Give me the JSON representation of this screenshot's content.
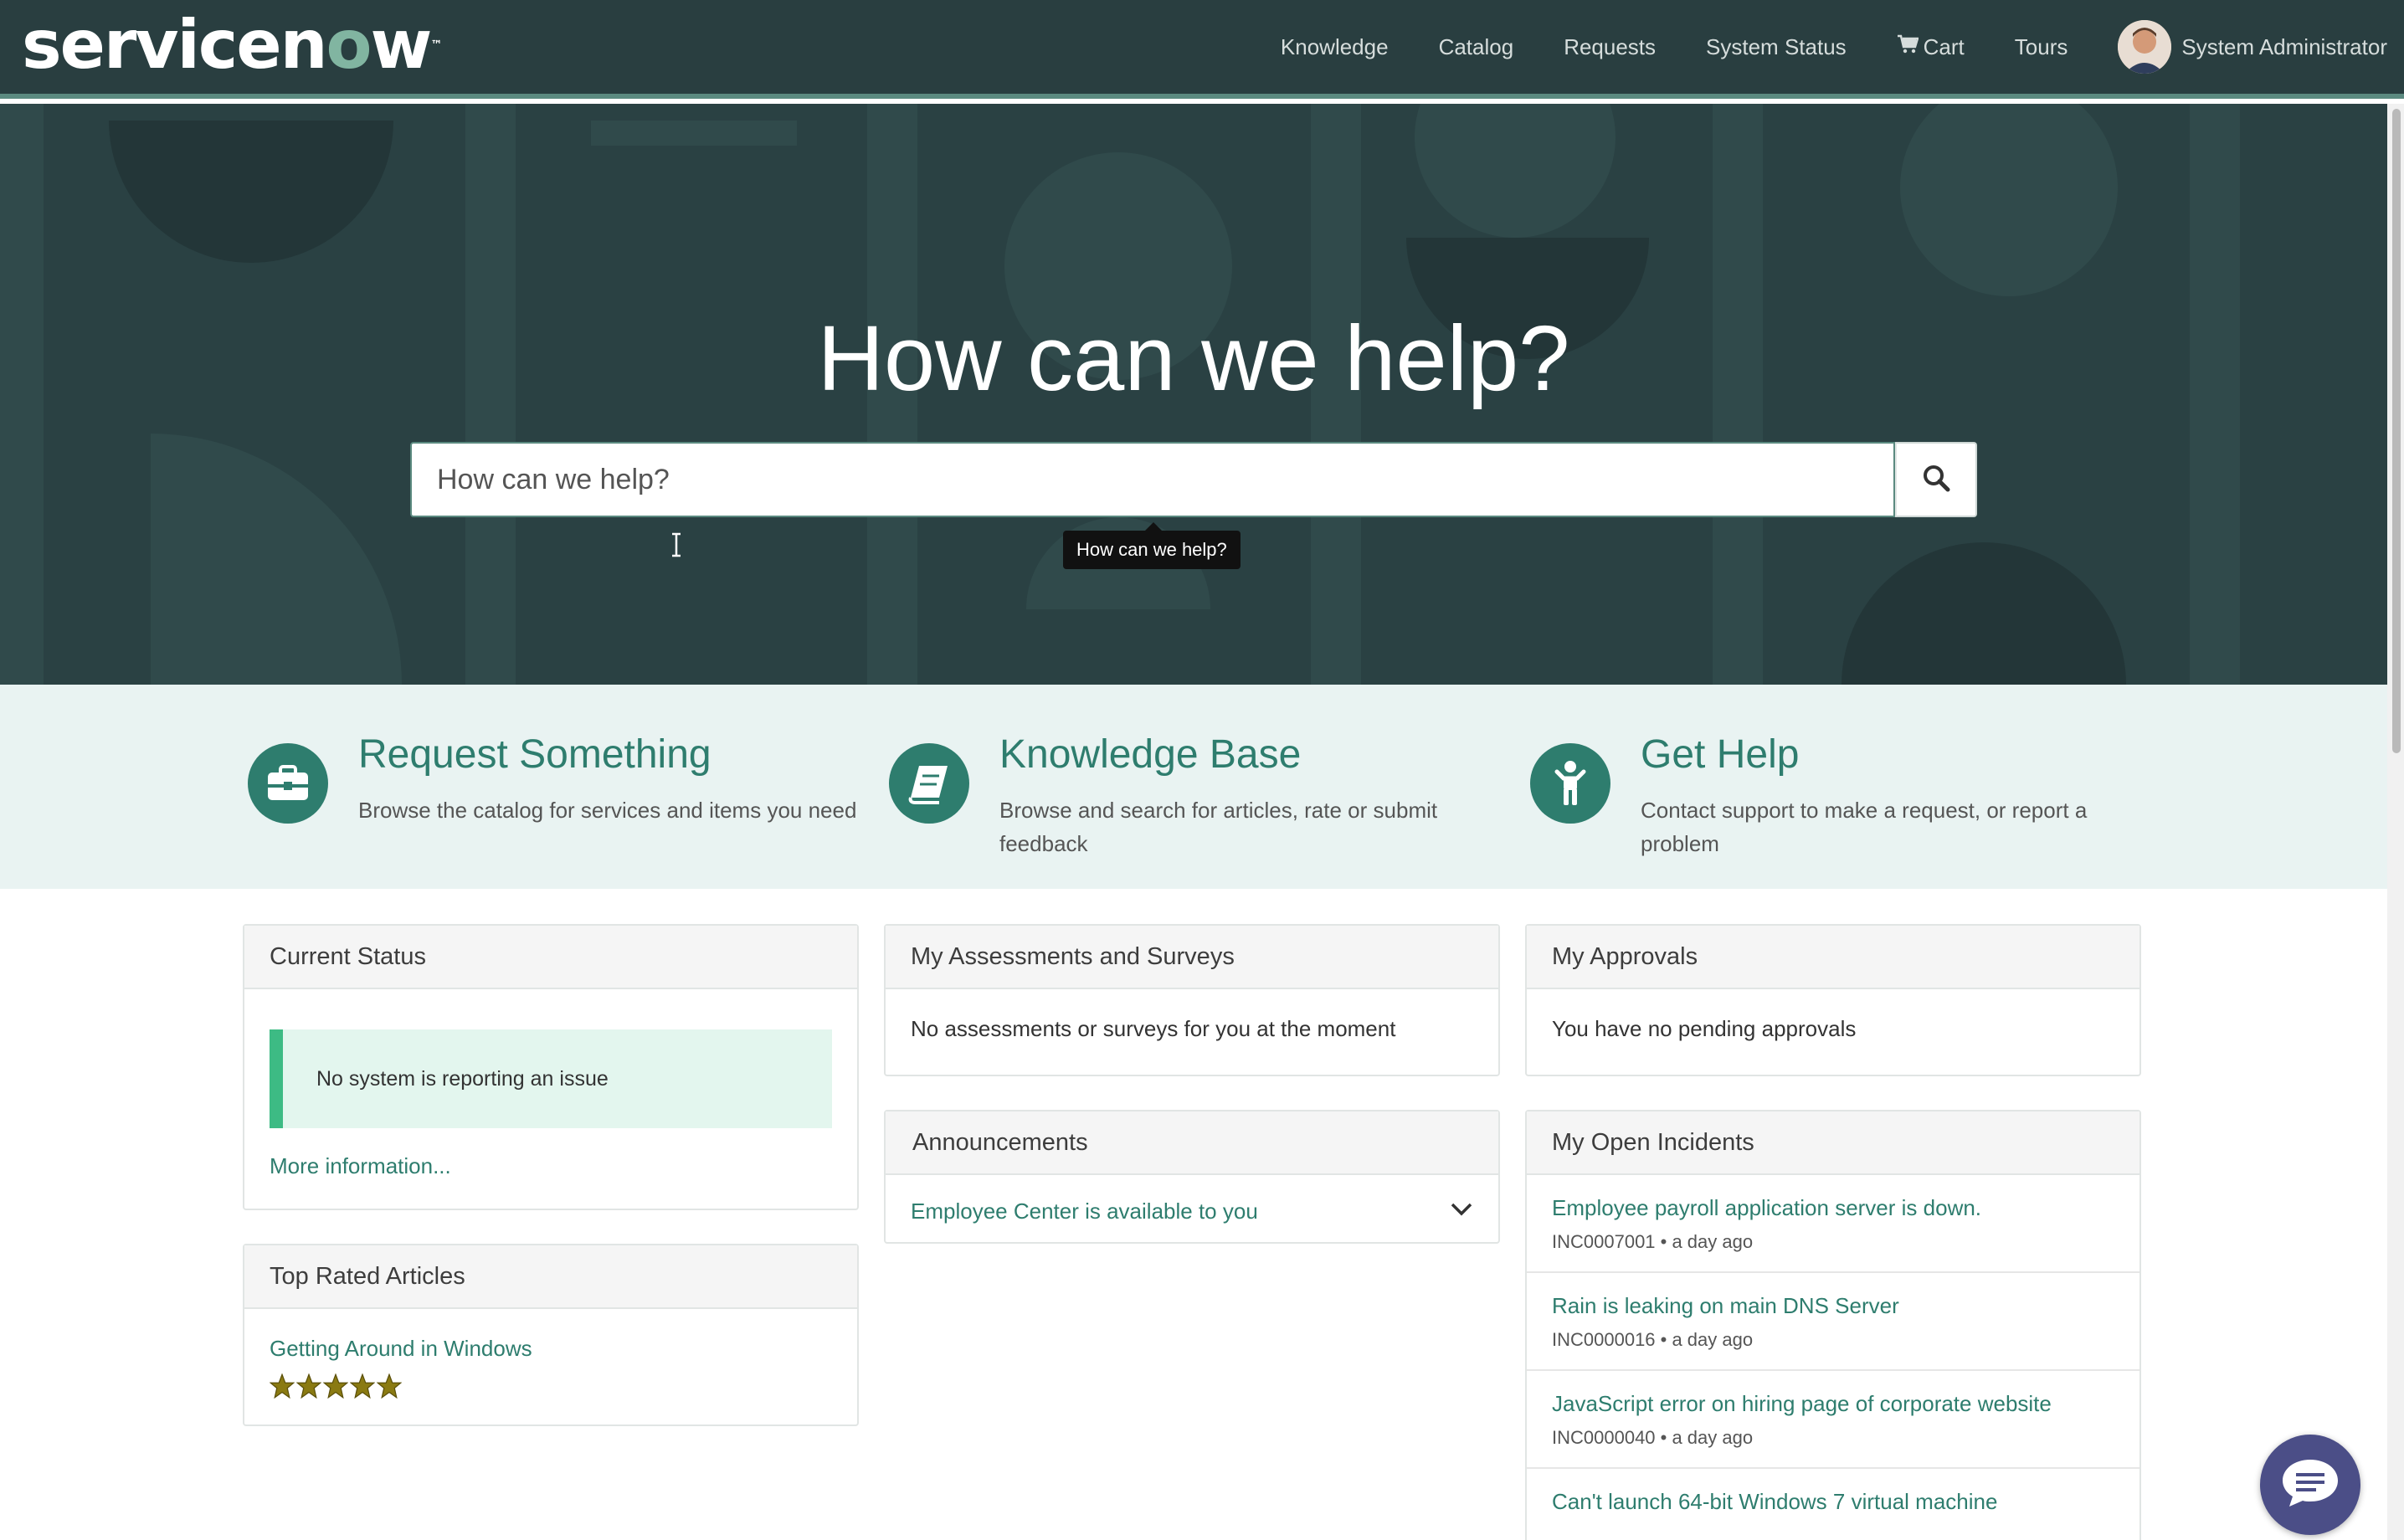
{
  "header": {
    "logo_text_a": "servicen",
    "logo_text_b": "o",
    "logo_text_c": "w",
    "logo_tm": "™",
    "nav": [
      "Knowledge",
      "Catalog",
      "Requests",
      "System Status",
      "Cart",
      "Tours"
    ],
    "user_name": "System Administrator"
  },
  "hero": {
    "title": "How can we help?",
    "search_placeholder": "How can we help?",
    "tooltip": "How can we help?"
  },
  "quick_links": [
    {
      "title": "Request Something",
      "desc": "Browse the catalog for services and items you need",
      "icon": "briefcase-icon"
    },
    {
      "title": "Knowledge Base",
      "desc": "Browse and search for articles, rate or submit feedback",
      "icon": "book-icon"
    },
    {
      "title": "Get Help",
      "desc": "Contact support to make a request, or report a problem",
      "icon": "person-help-icon"
    }
  ],
  "current_status": {
    "title": "Current Status",
    "message": "No system is reporting an issue",
    "more": "More information..."
  },
  "top_rated": {
    "title": "Top Rated Articles",
    "article": "Getting Around in Windows",
    "rating": 5
  },
  "assessments": {
    "title": "My Assessments and Surveys",
    "message": "No assessments or surveys for you at the moment"
  },
  "announcements": {
    "title": "Announcements",
    "item": "Employee Center is available to you"
  },
  "approvals": {
    "title": "My Approvals",
    "message": "You have no pending approvals"
  },
  "incidents": {
    "title": "My Open Incidents",
    "items": [
      {
        "title": "Employee payroll application server is down.",
        "meta": "INC0007001 • a day ago"
      },
      {
        "title": "Rain is leaking on main DNS Server",
        "meta": "INC0000016 • a day ago"
      },
      {
        "title": "JavaScript error on hiring page of corporate website",
        "meta": "INC0000040 • a day ago"
      },
      {
        "title": "Can't launch 64-bit Windows 7 virtual machine",
        "meta": ""
      }
    ]
  },
  "colors": {
    "header_bg": "#293e40",
    "accent": "#2e7d6e",
    "status_green": "#3dbb84",
    "quick_bg": "#e9f3f2",
    "chat": "#4b4e87"
  }
}
